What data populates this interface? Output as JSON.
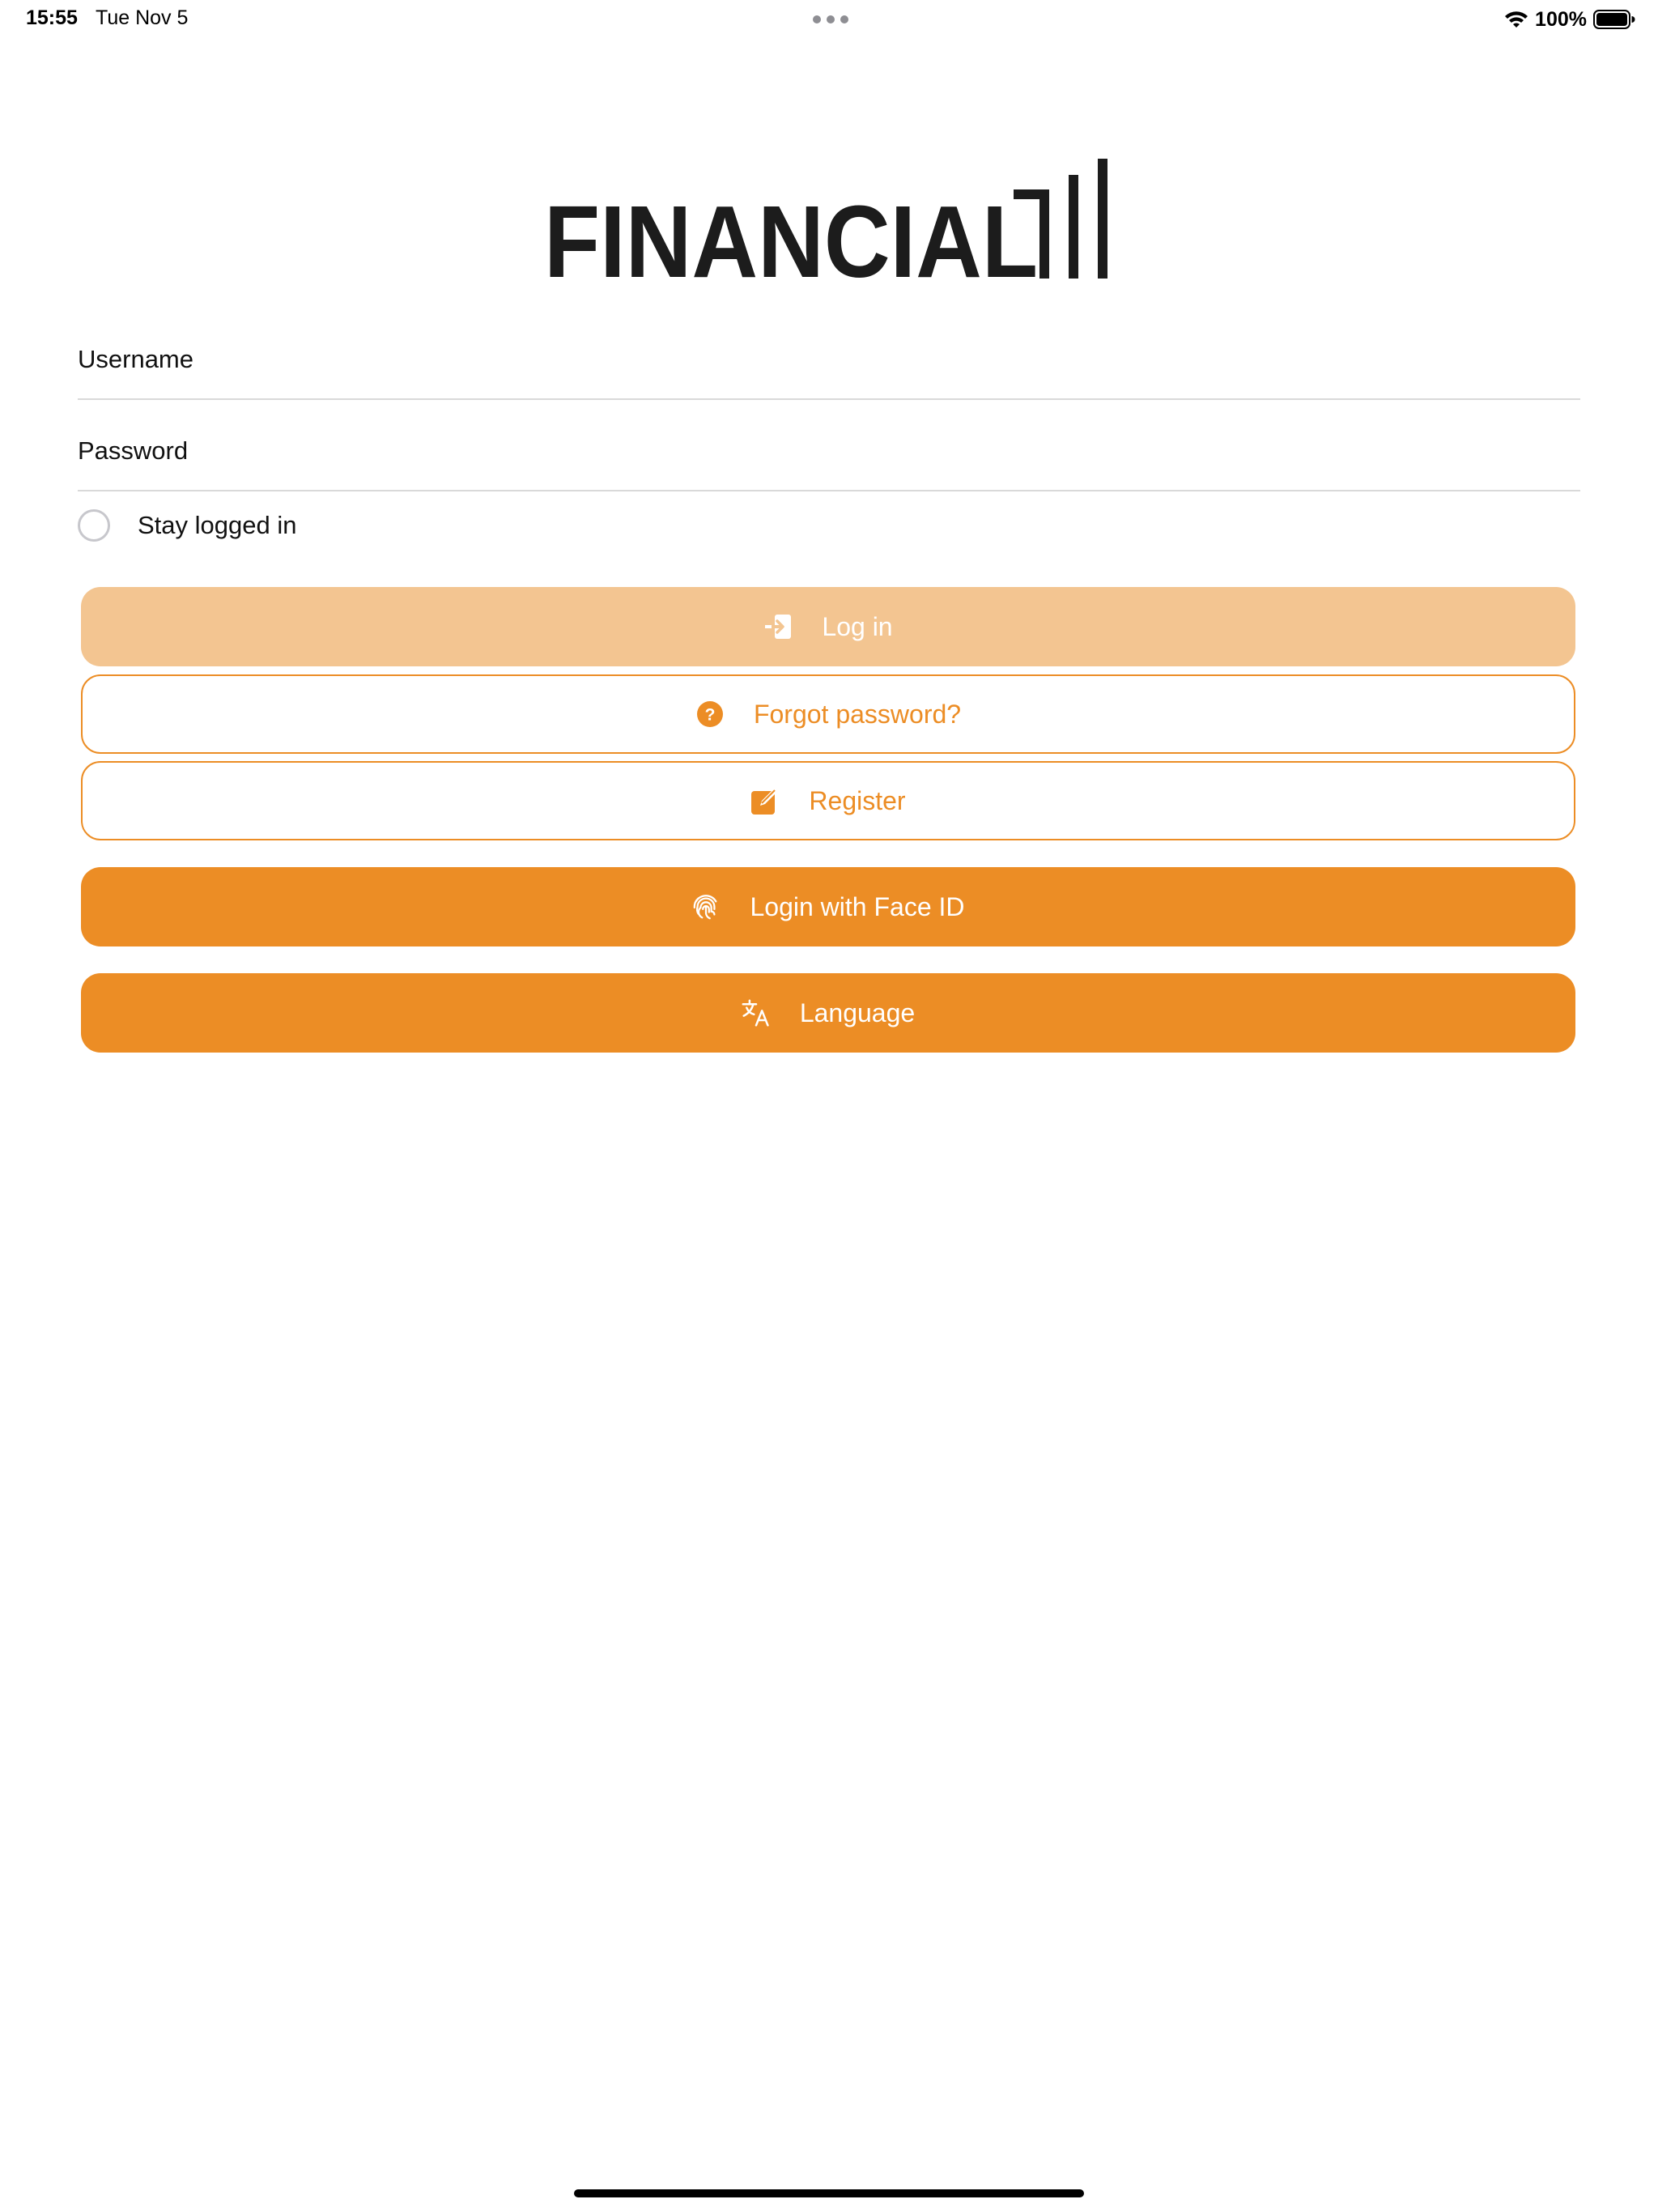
{
  "status_bar": {
    "time": "15:55",
    "date": "Tue Nov 5",
    "battery": "100%",
    "wifi_icon": "wifi-icon",
    "battery_icon": "battery-full-icon"
  },
  "logo": {
    "text": "FINANCIAL"
  },
  "form": {
    "username_placeholder": "Username",
    "username_value": "",
    "password_placeholder": "Password",
    "password_value": "",
    "stay_logged_in_label": "Stay logged in",
    "stay_logged_in_checked": false
  },
  "buttons": {
    "login": {
      "label": "Log in",
      "icon": "login-arrow-icon",
      "enabled": false
    },
    "forgot": {
      "label": "Forgot password?",
      "icon": "question-circle-icon"
    },
    "register": {
      "label": "Register",
      "icon": "edit-square-icon"
    },
    "faceid": {
      "label": "Login with Face ID",
      "icon": "fingerprint-icon"
    },
    "language": {
      "label": "Language",
      "icon": "translate-icon"
    }
  },
  "colors": {
    "accent": "#ec8d25",
    "accent_disabled": "#f3c591",
    "text": "#111111",
    "divider": "#d9d9d9"
  }
}
